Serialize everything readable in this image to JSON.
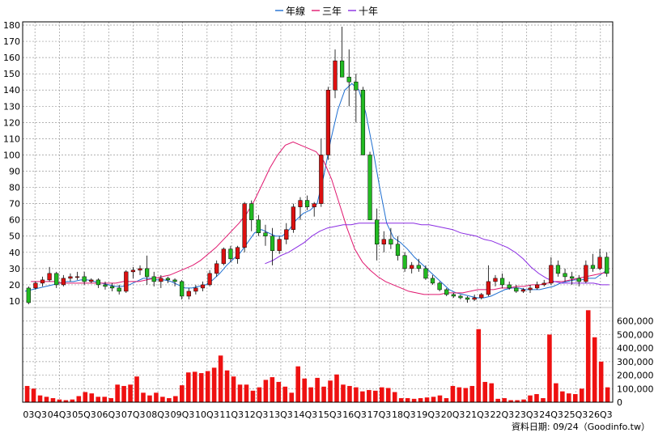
{
  "chart_data": {
    "type": "candlestick-with-volume",
    "legend": [
      {
        "label": "年線",
        "color": "#1f6fd1"
      },
      {
        "label": "三年",
        "color": "#e0176f"
      },
      {
        "label": "十年",
        "color": "#8a2be2"
      }
    ],
    "price_axis": {
      "ylim": [
        5,
        182
      ],
      "ticks": [
        10,
        20,
        30,
        40,
        50,
        60,
        70,
        80,
        90,
        100,
        110,
        120,
        130,
        140,
        150,
        160,
        170,
        180
      ],
      "grid": true
    },
    "volume_axis": {
      "ylim": [
        0,
        700000
      ],
      "ticks": [
        0,
        100000,
        200000,
        300000,
        400000,
        500000,
        600000
      ],
      "tick_labels": [
        "0",
        "100,000",
        "200,000",
        "300,000",
        "400,000",
        "500,000",
        "600,000"
      ]
    },
    "x_labels": [
      "03Q3",
      "04Q3",
      "05Q3",
      "06Q3",
      "07Q3",
      "08Q3",
      "09Q3",
      "10Q3",
      "11Q3",
      "12Q3",
      "13Q3",
      "14Q3",
      "15Q3",
      "16Q3",
      "17Q3",
      "18Q3",
      "19Q3",
      "20Q3",
      "21Q3",
      "22Q3",
      "23Q3",
      "24Q3",
      "25Q3",
      "26Q3"
    ],
    "candle_colors": {
      "up": "#dd1111",
      "down": "#22bb22",
      "volume": "#ee1111"
    },
    "candles": [
      {
        "o": 18,
        "h": 19,
        "l": 8,
        "c": 9
      },
      {
        "o": 18,
        "h": 22,
        "l": 17,
        "c": 21
      },
      {
        "o": 21,
        "h": 25,
        "l": 19,
        "c": 23
      },
      {
        "o": 23,
        "h": 31,
        "l": 22,
        "c": 27
      },
      {
        "o": 27,
        "h": 28,
        "l": 18,
        "c": 20
      },
      {
        "o": 20,
        "h": 26,
        "l": 19,
        "c": 24
      },
      {
        "o": 24,
        "h": 27,
        "l": 22,
        "c": 25
      },
      {
        "o": 25,
        "h": 28,
        "l": 23,
        "c": 25
      },
      {
        "o": 25,
        "h": 28,
        "l": 20,
        "c": 22
      },
      {
        "o": 22,
        "h": 24,
        "l": 21,
        "c": 23
      },
      {
        "o": 23,
        "h": 24,
        "l": 18,
        "c": 20
      },
      {
        "o": 20,
        "h": 22,
        "l": 17,
        "c": 19
      },
      {
        "o": 19,
        "h": 21,
        "l": 16,
        "c": 18
      },
      {
        "o": 18,
        "h": 20,
        "l": 14,
        "c": 16
      },
      {
        "o": 16,
        "h": 29,
        "l": 15,
        "c": 28
      },
      {
        "o": 28,
        "h": 31,
        "l": 24,
        "c": 29
      },
      {
        "o": 29,
        "h": 32,
        "l": 26,
        "c": 30
      },
      {
        "o": 30,
        "h": 38,
        "l": 20,
        "c": 25
      },
      {
        "o": 25,
        "h": 28,
        "l": 19,
        "c": 22
      },
      {
        "o": 22,
        "h": 26,
        "l": 18,
        "c": 24
      },
      {
        "o": 24,
        "h": 25,
        "l": 21,
        "c": 23
      },
      {
        "o": 23,
        "h": 24,
        "l": 19,
        "c": 22
      },
      {
        "o": 22,
        "h": 23,
        "l": 11,
        "c": 13
      },
      {
        "o": 13,
        "h": 18,
        "l": 11,
        "c": 16
      },
      {
        "o": 16,
        "h": 20,
        "l": 14,
        "c": 18
      },
      {
        "o": 18,
        "h": 22,
        "l": 16,
        "c": 20
      },
      {
        "o": 20,
        "h": 29,
        "l": 19,
        "c": 27
      },
      {
        "o": 27,
        "h": 35,
        "l": 25,
        "c": 33
      },
      {
        "o": 33,
        "h": 43,
        "l": 32,
        "c": 42
      },
      {
        "o": 42,
        "h": 44,
        "l": 34,
        "c": 36
      },
      {
        "o": 36,
        "h": 44,
        "l": 33,
        "c": 43
      },
      {
        "o": 43,
        "h": 71,
        "l": 40,
        "c": 70
      },
      {
        "o": 70,
        "h": 72,
        "l": 53,
        "c": 60
      },
      {
        "o": 60,
        "h": 63,
        "l": 50,
        "c": 52
      },
      {
        "o": 52,
        "h": 57,
        "l": 44,
        "c": 50
      },
      {
        "o": 50,
        "h": 55,
        "l": 32,
        "c": 41
      },
      {
        "o": 41,
        "h": 50,
        "l": 39,
        "c": 48
      },
      {
        "o": 48,
        "h": 58,
        "l": 45,
        "c": 54
      },
      {
        "o": 54,
        "h": 70,
        "l": 52,
        "c": 68
      },
      {
        "o": 68,
        "h": 74,
        "l": 60,
        "c": 72
      },
      {
        "o": 72,
        "h": 75,
        "l": 66,
        "c": 68
      },
      {
        "o": 68,
        "h": 71,
        "l": 62,
        "c": 70
      },
      {
        "o": 70,
        "h": 110,
        "l": 68,
        "c": 100
      },
      {
        "o": 100,
        "h": 142,
        "l": 97,
        "c": 140
      },
      {
        "o": 140,
        "h": 165,
        "l": 135,
        "c": 158
      },
      {
        "o": 158,
        "h": 179,
        "l": 148,
        "c": 148
      },
      {
        "o": 148,
        "h": 165,
        "l": 130,
        "c": 145
      },
      {
        "o": 145,
        "h": 150,
        "l": 120,
        "c": 140
      },
      {
        "o": 140,
        "h": 142,
        "l": 100,
        "c": 100
      },
      {
        "o": 100,
        "h": 102,
        "l": 70,
        "c": 60
      },
      {
        "o": 60,
        "h": 67,
        "l": 35,
        "c": 45
      },
      {
        "o": 45,
        "h": 53,
        "l": 40,
        "c": 48
      },
      {
        "o": 48,
        "h": 55,
        "l": 42,
        "c": 45
      },
      {
        "o": 45,
        "h": 50,
        "l": 35,
        "c": 38
      },
      {
        "o": 38,
        "h": 40,
        "l": 28,
        "c": 30
      },
      {
        "o": 30,
        "h": 34,
        "l": 27,
        "c": 32
      },
      {
        "o": 32,
        "h": 36,
        "l": 28,
        "c": 30
      },
      {
        "o": 30,
        "h": 32,
        "l": 23,
        "c": 24
      },
      {
        "o": 24,
        "h": 26,
        "l": 20,
        "c": 21
      },
      {
        "o": 21,
        "h": 22,
        "l": 16,
        "c": 17
      },
      {
        "o": 17,
        "h": 18,
        "l": 13,
        "c": 14
      },
      {
        "o": 14,
        "h": 15,
        "l": 12,
        "c": 13
      },
      {
        "o": 13,
        "h": 14,
        "l": 11,
        "c": 12
      },
      {
        "o": 12,
        "h": 13,
        "l": 9,
        "c": 11
      },
      {
        "o": 11,
        "h": 14,
        "l": 10,
        "c": 12
      },
      {
        "o": 12,
        "h": 15,
        "l": 11,
        "c": 14
      },
      {
        "o": 14,
        "h": 32,
        "l": 13,
        "c": 22
      },
      {
        "o": 22,
        "h": 26,
        "l": 19,
        "c": 24
      },
      {
        "o": 24,
        "h": 27,
        "l": 18,
        "c": 20
      },
      {
        "o": 20,
        "h": 22,
        "l": 17,
        "c": 18
      },
      {
        "o": 18,
        "h": 20,
        "l": 15,
        "c": 16
      },
      {
        "o": 16,
        "h": 18,
        "l": 15,
        "c": 17
      },
      {
        "o": 17,
        "h": 20,
        "l": 15,
        "c": 18
      },
      {
        "o": 18,
        "h": 22,
        "l": 17,
        "c": 20
      },
      {
        "o": 20,
        "h": 23,
        "l": 19,
        "c": 21
      },
      {
        "o": 21,
        "h": 37,
        "l": 20,
        "c": 32
      },
      {
        "o": 32,
        "h": 35,
        "l": 25,
        "c": 27
      },
      {
        "o": 27,
        "h": 30,
        "l": 22,
        "c": 25
      },
      {
        "o": 25,
        "h": 28,
        "l": 20,
        "c": 24
      },
      {
        "o": 24,
        "h": 26,
        "l": 19,
        "c": 22
      },
      {
        "o": 22,
        "h": 35,
        "l": 21,
        "c": 32
      },
      {
        "o": 32,
        "h": 39,
        "l": 28,
        "c": 30
      },
      {
        "o": 30,
        "h": 42,
        "l": 29,
        "c": 37
      },
      {
        "o": 37,
        "h": 40,
        "l": 25,
        "c": 27
      }
    ],
    "volumes": [
      120000,
      100000,
      50000,
      40000,
      30000,
      20000,
      15000,
      20000,
      45000,
      75000,
      65000,
      40000,
      40000,
      30000,
      130000,
      120000,
      130000,
      190000,
      70000,
      50000,
      70000,
      40000,
      30000,
      45000,
      125000,
      220000,
      225000,
      215000,
      230000,
      255000,
      345000,
      235000,
      190000,
      130000,
      130000,
      85000,
      110000,
      165000,
      185000,
      150000,
      115000,
      70000,
      265000,
      175000,
      110000,
      180000,
      115000,
      160000,
      205000,
      130000,
      120000,
      110000,
      80000,
      90000,
      85000,
      110000,
      105000,
      75000,
      30000,
      30000,
      25000,
      30000,
      35000,
      40000,
      50000,
      30000,
      120000,
      110000,
      105000,
      120000,
      540000,
      150000,
      140000,
      25000,
      30000,
      15000,
      15000,
      20000,
      50000,
      60000,
      30000,
      500000,
      140000,
      80000,
      65000,
      60000,
      100000,
      680000,
      480000,
      300000,
      110000
    ],
    "series": [
      {
        "name": "年線",
        "values": [
          16,
          17,
          18,
          19,
          20,
          21,
          22,
          22,
          23,
          23,
          22,
          21,
          20,
          19,
          19,
          20,
          22,
          24,
          24,
          23,
          23,
          22,
          20,
          18,
          18,
          19,
          20,
          23,
          27,
          32,
          36,
          40,
          46,
          52,
          54,
          52,
          50,
          50,
          54,
          60,
          64,
          66,
          70,
          88,
          110,
          128,
          140,
          144,
          140,
          126,
          104,
          80,
          58,
          49,
          46,
          42,
          37,
          33,
          29,
          25,
          21,
          17,
          15,
          14,
          13,
          12,
          12,
          13,
          15,
          17,
          18,
          18,
          17,
          17,
          17,
          18,
          19,
          21,
          22,
          23,
          23,
          24,
          24,
          27,
          30
        ]
      },
      {
        "name": "三年",
        "values": [
          22,
          22,
          22,
          22,
          21,
          21,
          21,
          21,
          21,
          21,
          21,
          21,
          22,
          22,
          22,
          23,
          24,
          25,
          26,
          28,
          30,
          32,
          35,
          39,
          43,
          48,
          53,
          58,
          64,
          72,
          82,
          92,
          100,
          106,
          108,
          106,
          104,
          102,
          96,
          85,
          70,
          55,
          42,
          34,
          29,
          25,
          22,
          20,
          18,
          16,
          15,
          14,
          14,
          14,
          15,
          15,
          15,
          16,
          17,
          17,
          17,
          18,
          18,
          19,
          19,
          20,
          20,
          21,
          22,
          22,
          23,
          24,
          25,
          26,
          27,
          28
        ]
      },
      {
        "name": "十年",
        "values": [
          33,
          35,
          38,
          40,
          43,
          46,
          50,
          53,
          55,
          56,
          57,
          57,
          58,
          58,
          58,
          58,
          58,
          58,
          58,
          58,
          57,
          57,
          56,
          55,
          54,
          52,
          51,
          50,
          48,
          47,
          45,
          43,
          40,
          36,
          31,
          27,
          24,
          22,
          21,
          21,
          21,
          21,
          21,
          20,
          20
        ]
      }
    ]
  },
  "footer": {
    "source": "資料日期: 09/24（Goodinfo.tw）"
  }
}
